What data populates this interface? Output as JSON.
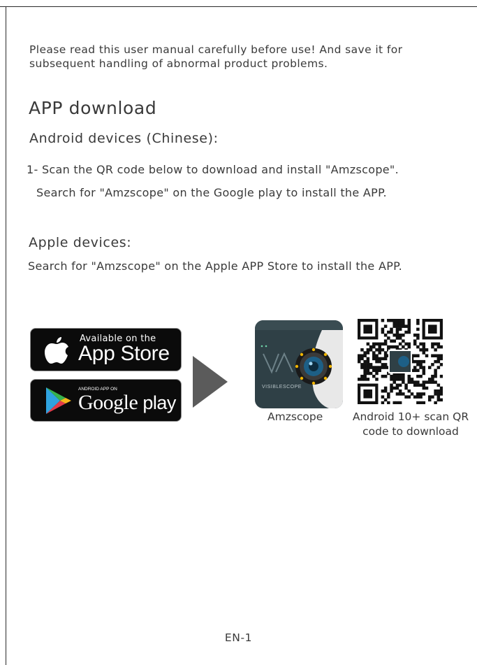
{
  "intro": "Please read this user manual carefully before use! And save it for subsequent handling of abnormal product problems.",
  "heading_app": "APP download",
  "heading_android": "Android devices (Chinese):",
  "step1": "1- Scan the QR code below to download and install \"Amzscope\".",
  "google_play_line": "Search for \"Amzscope\" on the  Google play to install the APP.",
  "heading_apple": "Apple devices:",
  "apple_line": "Search for \"Amzscope\" on the Apple APP Store  to install the APP.",
  "appstore_badge": {
    "small": "Available on the",
    "big": "App Store"
  },
  "googleplay_badge": {
    "small": "ANDROID APP ON",
    "big_google": "Google",
    "big_play": " play"
  },
  "app_icon": {
    "brand": "VISIBLESCOPE"
  },
  "caption_app": "Amzscope",
  "caption_qr": "Android 10+ scan QR code to download",
  "page_number": "EN-1"
}
